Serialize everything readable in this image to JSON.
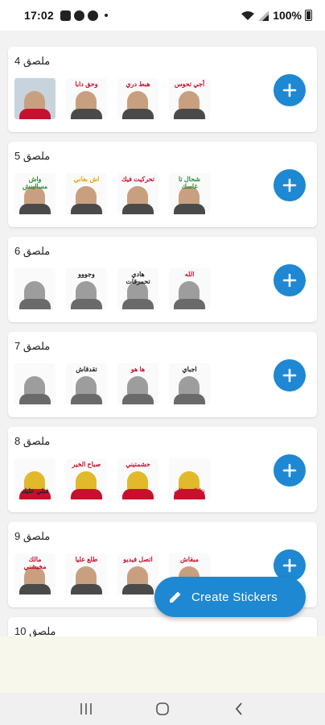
{
  "status_bar": {
    "time": "17:02",
    "battery_text": "100%",
    "notification_icons": [
      "gallery-icon",
      "messenger-icon",
      "whatsapp-icon"
    ]
  },
  "packs": [
    {
      "title": "ملصق 4",
      "captions": [
        "",
        "وحق دابا",
        "هبط دري",
        "أجي تحوس"
      ]
    },
    {
      "title": "ملصق 5",
      "captions": [
        "واش مسالينش",
        "اش بغاني",
        "تحركيت فيك",
        "شحال تا غاسك"
      ]
    },
    {
      "title": "ملصق 6",
      "captions": [
        "",
        "وجووو",
        "هادي تحمرقات",
        "الله"
      ]
    },
    {
      "title": "ملصق 7",
      "captions": [
        "",
        "تقدقاش",
        "ها هو",
        "اجباي"
      ]
    },
    {
      "title": "ملصق 8",
      "captions": [
        "فبلي عليك",
        "صباح الخير",
        "حشمتيني",
        "نتا الشيطان"
      ]
    },
    {
      "title": "ملصق 9",
      "captions": [
        "مالك مخيشني",
        "طلع عليا",
        "اتصل فيديو",
        "مبقاش"
      ]
    },
    {
      "title": "ملصق 10",
      "captions": []
    }
  ],
  "fab": {
    "label": "Create Stickers",
    "icon": "pencil-icon"
  },
  "accent_color": "#1e88d2"
}
